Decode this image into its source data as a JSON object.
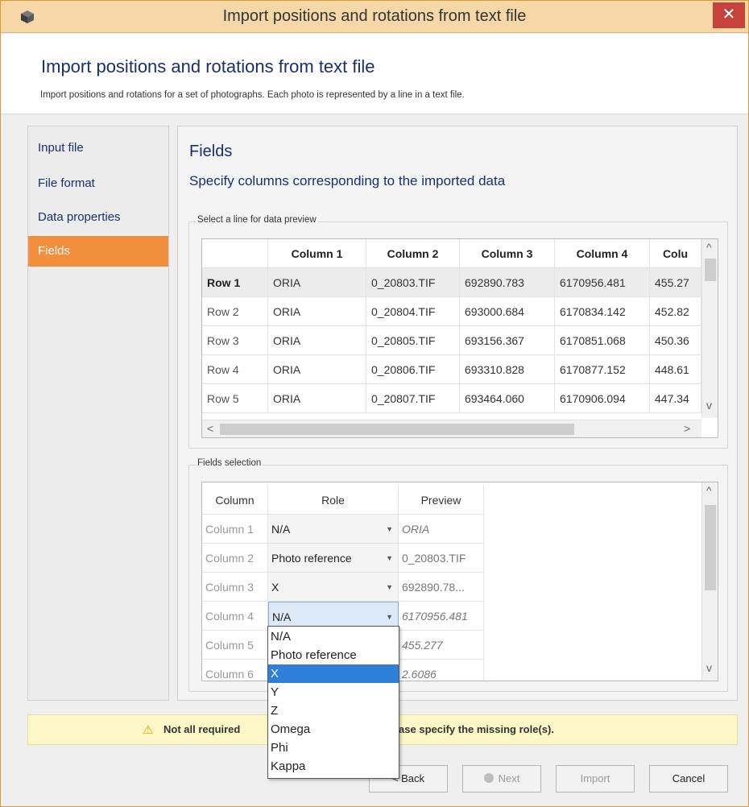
{
  "window": {
    "title": "Import positions and rotations from text file",
    "close_glyph": "✕",
    "app_icon": "cube-icon"
  },
  "header": {
    "title": "Import positions and rotations from text file",
    "description": "Import positions and rotations for a set of photographs. Each photo is represented by a line in a text file."
  },
  "nav": {
    "items": [
      {
        "label": "Input file"
      },
      {
        "label": "File format"
      },
      {
        "label": "Data properties"
      },
      {
        "label": "Fields"
      }
    ],
    "active_index": 3,
    "active_color": "#f28e3c"
  },
  "content": {
    "title": "Fields",
    "subtitle": "Specify columns corresponding to the imported data"
  },
  "preview": {
    "group_label": "Select a line for data preview",
    "columns": [
      "Column 1",
      "Column 2",
      "Column 3",
      "Column 4",
      "Colu"
    ],
    "rows": [
      {
        "header": "Row 1",
        "cells": [
          "ORIA",
          "0_20803.TIF",
          "692890.783",
          "6170956.481",
          "455.27"
        ]
      },
      {
        "header": "Row 2",
        "cells": [
          "ORIA",
          "0_20804.TIF",
          "693000.684",
          "6170834.142",
          "452.82"
        ]
      },
      {
        "header": "Row 3",
        "cells": [
          "ORIA",
          "0_20805.TIF",
          "693156.367",
          "6170851.068",
          "450.36"
        ]
      },
      {
        "header": "Row 4",
        "cells": [
          "ORIA",
          "0_20806.TIF",
          "693310.828",
          "6170877.152",
          "448.61"
        ]
      },
      {
        "header": "Row 5",
        "cells": [
          "ORIA",
          "0_20807.TIF",
          "693464.060",
          "6170906.094",
          "447.34"
        ]
      }
    ],
    "selected_row": 0,
    "scroll_left": "<",
    "scroll_right": ">",
    "scroll_up": "^",
    "scroll_down": "v"
  },
  "fields": {
    "group_label": "Fields selection",
    "headers": {
      "column": "Column",
      "role": "Role",
      "preview": "Preview"
    },
    "rows": [
      {
        "column": "Column 1",
        "role": "N/A",
        "preview": "ORIA",
        "italic": true
      },
      {
        "column": "Column 2",
        "role": "Photo reference",
        "preview": "0_20803.TIF",
        "italic": false
      },
      {
        "column": "Column 3",
        "role": "X",
        "preview": "692890.78...",
        "italic": false
      },
      {
        "column": "Column 4",
        "role": "N/A",
        "preview": "6170956.481",
        "italic": true
      },
      {
        "column": "Column 5",
        "role": "",
        "preview": "455.277",
        "italic": true
      },
      {
        "column": "Column 6",
        "role": "",
        "preview": "2.6086",
        "italic": true
      }
    ],
    "active_row": 3,
    "scroll_up": "^",
    "scroll_down": "v"
  },
  "dropdown": {
    "options": [
      "N/A",
      "Photo reference",
      "X",
      "Y",
      "Z",
      "Omega",
      "Phi",
      "Kappa"
    ],
    "selected_index": 2,
    "highlight_color": "#2e7fd8"
  },
  "warning": {
    "icon": "warning-icon",
    "text_before": "Not all required",
    "text_after": "d. Please specify the missing role(s)."
  },
  "buttons": {
    "back": "< Back",
    "next": "Next",
    "import": "Import",
    "cancel": "Cancel"
  }
}
